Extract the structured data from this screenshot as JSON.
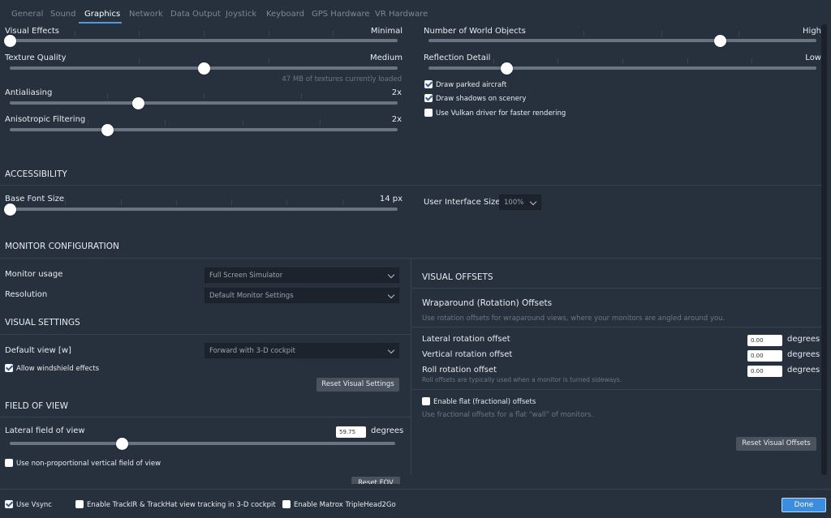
{
  "tabs": [
    "General",
    "Sound",
    "Graphics",
    "Network",
    "Data Output",
    "Joystick",
    "Keyboard",
    "GPS Hardware",
    "VR Hardware"
  ],
  "graphics": {
    "visual_effects": {
      "label": "Visual Effects",
      "value": "Minimal",
      "level": 0.0
    },
    "texture_quality": {
      "label": "Texture Quality",
      "value": "Medium",
      "level": 0.5,
      "hint": "47 MB of textures currently loaded"
    },
    "antialiasing": {
      "label": "Antialiasing",
      "value": "2x",
      "level": 0.33
    },
    "anisotropic": {
      "label": "Anisotropic Filtering",
      "value": "2x",
      "level": 0.25
    },
    "world_objects": {
      "label": "Number of World Objects",
      "value": "High",
      "level": 0.75
    },
    "reflection": {
      "label": "Reflection Detail",
      "value": "Low",
      "level": 0.2
    },
    "checks": [
      {
        "label": "Draw parked aircraft",
        "checked": true
      },
      {
        "label": "Draw shadows on scenery",
        "checked": true
      },
      {
        "label": "Use Vulkan driver for faster rendering",
        "checked": false
      }
    ]
  },
  "accessibility": {
    "title": "ACCESSIBILITY",
    "font_size": {
      "label": "Base Font Size",
      "value": "14 px",
      "level": 0.0
    },
    "ui_size": {
      "label": "User Interface Size",
      "value": "100%"
    }
  },
  "monitor": {
    "title": "MONITOR CONFIGURATION",
    "usage_label": "Monitor usage",
    "usage_value": "Full Screen Simulator",
    "resolution_label": "Resolution",
    "resolution_value": "Default Monitor Settings"
  },
  "visual_settings": {
    "title": "VISUAL SETTINGS",
    "default_view_label": "Default view [w]",
    "default_view_value": "Forward with 3-D cockpit",
    "windshield_label": "Allow windshield effects",
    "windshield_checked": true,
    "reset_label": "Reset Visual Settings"
  },
  "fov": {
    "title": "FIELD OF VIEW",
    "lateral_label": "Lateral field of view",
    "lateral_value": "59.75",
    "unit": "degrees",
    "level": 0.29,
    "nonprop_label": "Use non-proportional vertical field of view",
    "nonprop_checked": false,
    "reset_label": "Reset FOV"
  },
  "offsets": {
    "title": "VISUAL OFFSETS",
    "subtitle": "Wraparound (Rotation) Offsets",
    "desc": "Use rotation offsets for wraparound views, where your monitors are angled around you.",
    "lateral_label": "Lateral rotation offset",
    "lateral_value": "0.00",
    "vertical_label": "Vertical rotation offset",
    "vertical_value": "0.00",
    "roll_label": "Roll rotation offset",
    "roll_value": "0.00",
    "roll_hint": "Roll offsets are typically used when a monitor is turned sideways.",
    "unit": "degrees",
    "flat_label": "Enable flat (fractional) offsets",
    "flat_checked": false,
    "flat_hint": "Use fractional offsets for a flat “wall” of monitors.",
    "reset_label": "Reset Visual Offsets"
  },
  "footer": {
    "vsync_label": "Use Vsync",
    "vsync_checked": true,
    "trackir_label": "Enable TrackIR & TrackHat view tracking in 3-D cockpit",
    "trackir_checked": false,
    "matrox_label": "Enable Matrox TripleHead2Go",
    "matrox_checked": false,
    "done_label": "Done"
  }
}
